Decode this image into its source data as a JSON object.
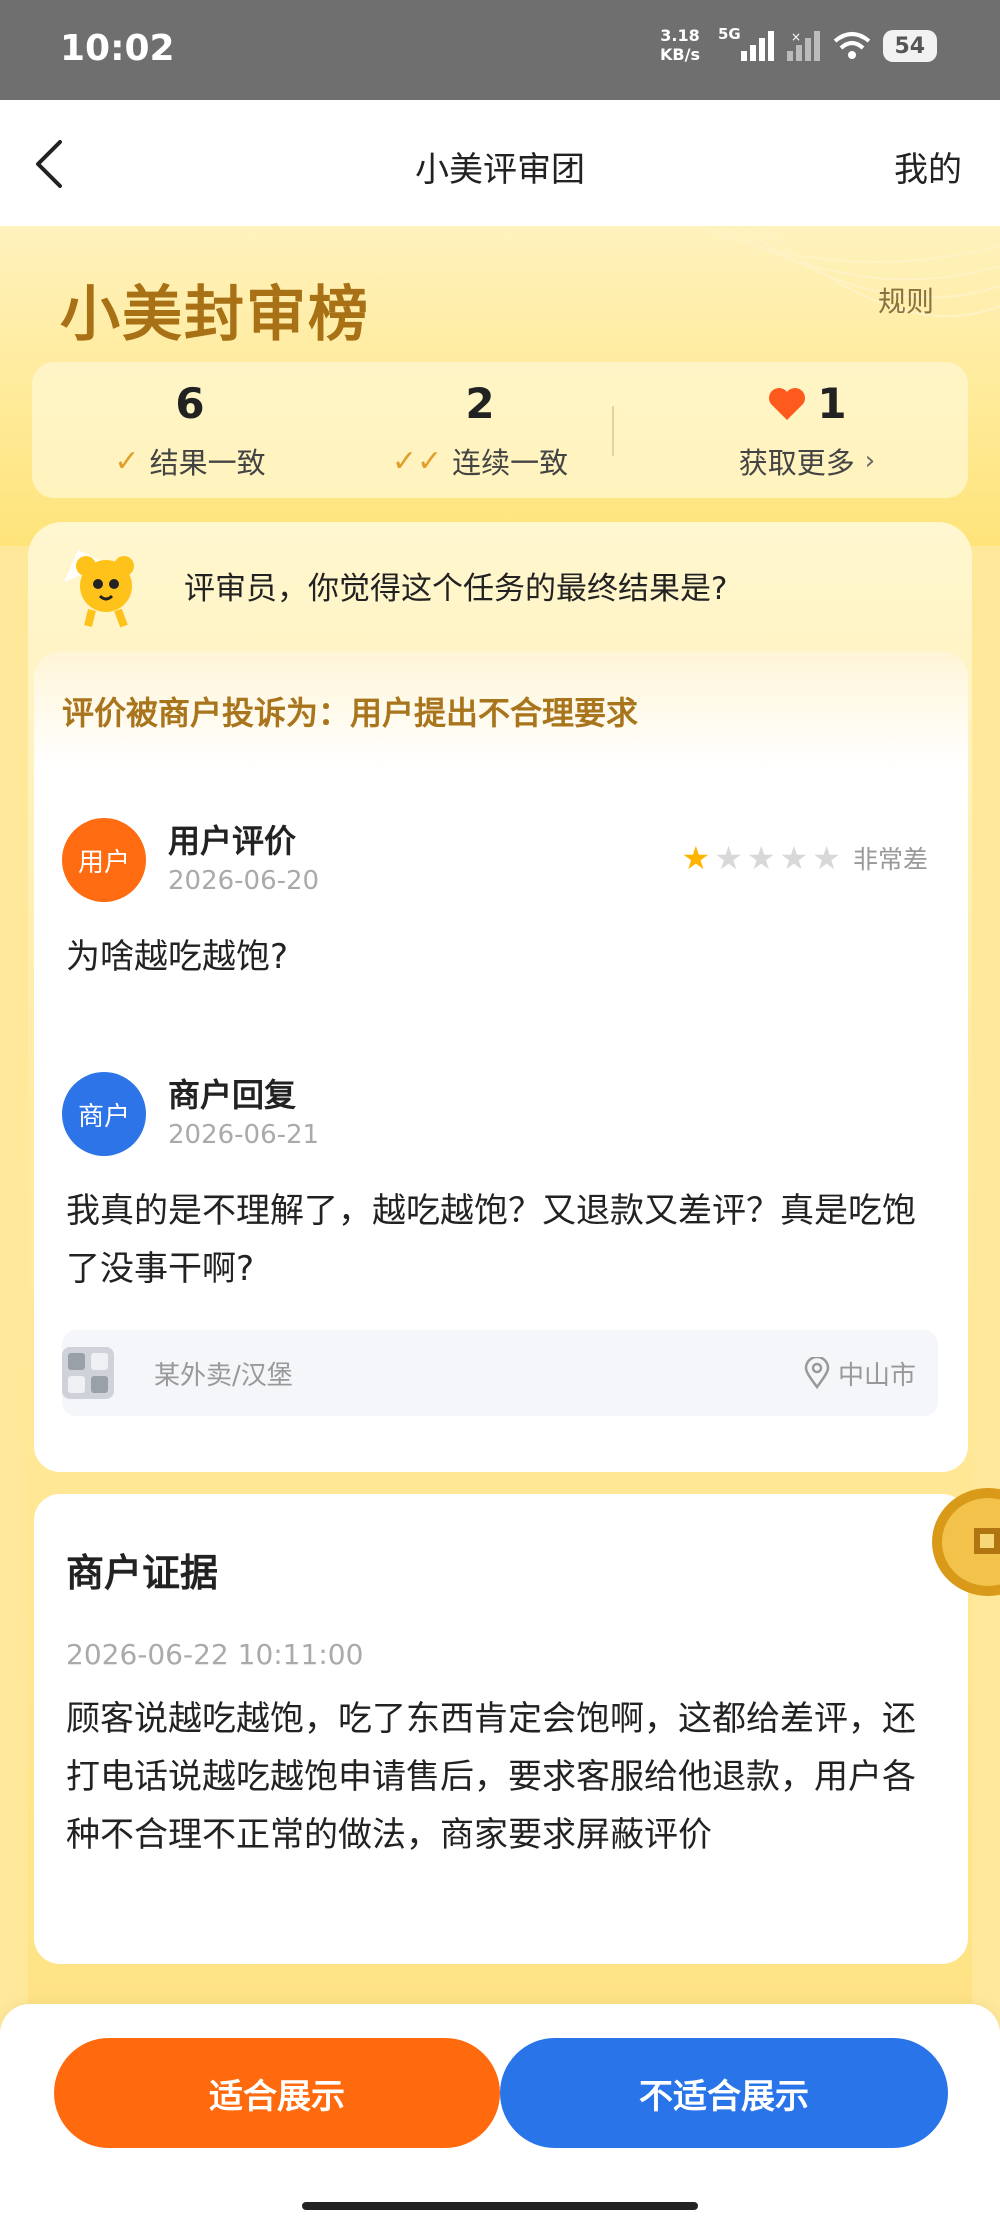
{
  "status_bar": {
    "time": "10:02",
    "net_speed_value": "3.18",
    "net_speed_unit": "KB/s",
    "network": "5G",
    "battery": "54"
  },
  "nav": {
    "title": "小美评审团",
    "mine": "我的"
  },
  "hero": {
    "logo": "小美封审榜",
    "rules": "规则"
  },
  "stats": [
    {
      "value": "6",
      "label": "结果一致"
    },
    {
      "value": "2",
      "label": "连续一致"
    },
    {
      "value": "1",
      "label": "获取更多"
    }
  ],
  "question": "评审员，你觉得这个任务的最终结果是?",
  "complaint": "评价被商户投诉为：用户提出不合理要求",
  "review": {
    "avatar": "用户",
    "title": "用户评价",
    "date": "2026-06-20",
    "rating": 1,
    "rating_text": "非常差",
    "body": "为啥越吃越饱?"
  },
  "reply": {
    "avatar": "商户",
    "title": "商户回复",
    "date": "2026-06-21",
    "body": "我真的是不理解了，越吃越饱？又退款又差评？真是吃饱了没事干啊?"
  },
  "shop": {
    "name": "某外卖/汉堡",
    "city": "中山市"
  },
  "evidence": {
    "title": "商户证据",
    "time": "2026-06-22 10:11:00",
    "body": "顾客说越吃越饱，吃了东西肯定会饱啊，这都给差评，还打电话说越吃越饱申请售后，要求客服给他退款，用户各种不合理不正常的做法，商家要求屏蔽评价"
  },
  "buttons": {
    "suitable": "适合展示",
    "unsuitable": "不适合展示"
  }
}
